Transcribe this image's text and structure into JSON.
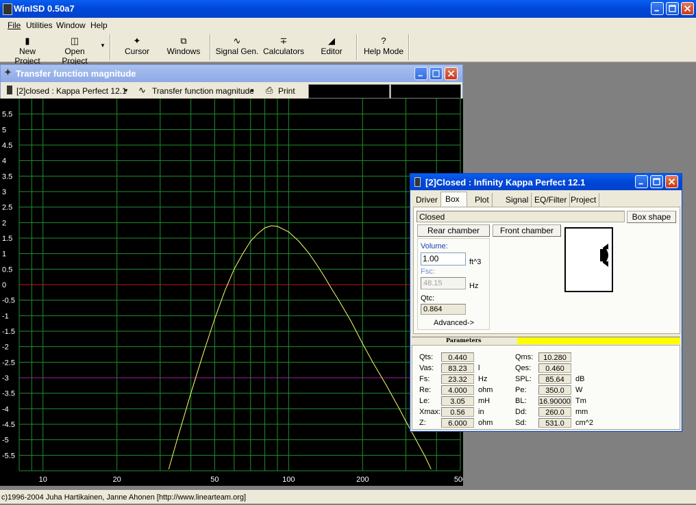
{
  "app": {
    "title": "WinISD 0.50a7"
  },
  "menu": [
    "File",
    "Utilities",
    "Window",
    "Help"
  ],
  "toolbar": [
    {
      "label": "New Project",
      "icon": "new-project-icon"
    },
    {
      "label": "Open Project",
      "icon": "open-project-icon"
    },
    {
      "label": "Cursor",
      "icon": "cursor-icon"
    },
    {
      "label": "Windows",
      "icon": "windows-icon"
    },
    {
      "label": "Signal Gen.",
      "icon": "signal-gen-icon"
    },
    {
      "label": "Calculators",
      "icon": "calculators-icon"
    },
    {
      "label": "Editor",
      "icon": "editor-icon"
    },
    {
      "label": "Help Mode",
      "icon": "help-mode-icon"
    }
  ],
  "graph_window": {
    "title": "Transfer function magnitude",
    "project_select": "[2]closed : Kappa Perfect 12.1",
    "plot_select": "Transfer function magnitude",
    "print_label": "Print"
  },
  "chart_data": {
    "type": "line",
    "xscale": "log",
    "xlim": [
      8,
      500
    ],
    "ylim": [
      -6,
      6
    ],
    "x_ticks": [
      10,
      20,
      50,
      100,
      200,
      500
    ],
    "y_ticks": [
      5.5,
      5,
      4.5,
      4,
      3.5,
      3,
      2.5,
      2,
      1.5,
      1,
      0.5,
      0,
      -0.5,
      -1,
      -1.5,
      -2,
      -2.5,
      -3,
      -3.5,
      -4,
      -4.5,
      -5,
      -5.5
    ],
    "series": [
      {
        "x": [
          32.5,
          35,
          40,
          45,
          50,
          55,
          60,
          65,
          70,
          75,
          80,
          85,
          90,
          100,
          110,
          120,
          130,
          140,
          150,
          160,
          180,
          200,
          220,
          250,
          280,
          300,
          330,
          360,
          380
        ],
        "y": [
          -5.95,
          -5.05,
          -3.5,
          -2.2,
          -1.1,
          -0.2,
          0.5,
          1.0,
          1.4,
          1.65,
          1.83,
          1.9,
          1.88,
          1.7,
          1.4,
          1.05,
          0.65,
          0.25,
          -0.15,
          -0.5,
          -1.2,
          -1.9,
          -2.5,
          -3.25,
          -3.95,
          -4.4,
          -5.0,
          -5.55,
          -5.95
        ],
        "color": "#ffff66"
      }
    ],
    "reference_lines": [
      {
        "y": 0,
        "color": "#d01010"
      },
      {
        "y": -3,
        "color": "#a020a0"
      }
    ],
    "grid_color": "#1f8f2f"
  },
  "dialog": {
    "title": "[2]Closed : Infinity Kappa Perfect 12.1",
    "tabs": [
      "Driver",
      "Box",
      "Plot",
      "Signal",
      "EQ/Filter",
      "Project"
    ],
    "active_tab": "Box",
    "box_type": "Closed",
    "box_shape_btn": "Box shape",
    "rear_chamber_btn": "Rear chamber",
    "front_chamber_btn": "Front chamber",
    "volume_label": "Volume:",
    "volume_value": "1.00",
    "volume_unit": "ft^3",
    "fsc_label": "Fsc:",
    "fsc_value": "48.15",
    "fsc_unit": "Hz",
    "qtc_label": "Qtc:",
    "qtc_value": "0.864",
    "advanced_btn": "Advanced->",
    "params_header": "Parameters",
    "params_left": [
      {
        "name": "Qts:",
        "value": "0.440",
        "unit": ""
      },
      {
        "name": "Vas:",
        "value": "83.23",
        "unit": "l"
      },
      {
        "name": "Fs:",
        "value": "23.32",
        "unit": "Hz"
      },
      {
        "name": "Re:",
        "value": "4.000",
        "unit": "ohm"
      },
      {
        "name": "Le:",
        "value": "3.05",
        "unit": "mH"
      },
      {
        "name": "Xmax:",
        "value": "0.56",
        "unit": "in"
      },
      {
        "name": "Z:",
        "value": "6.000",
        "unit": "ohm"
      }
    ],
    "params_right": [
      {
        "name": "Qms:",
        "value": "10.280",
        "unit": ""
      },
      {
        "name": "Qes:",
        "value": "0.460",
        "unit": ""
      },
      {
        "name": "SPL:",
        "value": "85.64",
        "unit": "dB"
      },
      {
        "name": "Pe:",
        "value": "350.0",
        "unit": "W"
      },
      {
        "name": "BL:",
        "value": "16.90000",
        "unit": "Tm"
      },
      {
        "name": "Dd:",
        "value": "260.0",
        "unit": "mm"
      },
      {
        "name": "Sd:",
        "value": "531.0",
        "unit": "cm^2"
      }
    ]
  },
  "status": "c)1996-2004 Juha Hartikainen, Janne Ahonen [http://www.linearteam.org]"
}
